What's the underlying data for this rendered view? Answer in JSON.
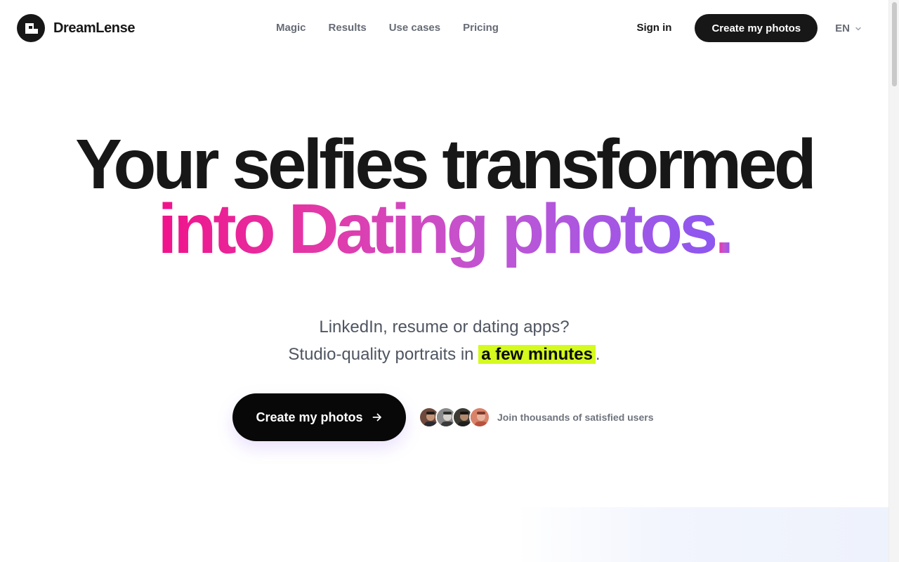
{
  "brand": {
    "name": "DreamLense",
    "logo_icon": "dreamlense-logo-icon"
  },
  "nav": {
    "items": [
      {
        "label": "Magic"
      },
      {
        "label": "Results"
      },
      {
        "label": "Use cases"
      },
      {
        "label": "Pricing"
      }
    ]
  },
  "header": {
    "signin_label": "Sign in",
    "cta_label": "Create my photos",
    "language": "EN",
    "language_icon": "chevron-down-icon"
  },
  "hero": {
    "title_line1": "Your selfies transformed",
    "title_line2_a": "into Dating photos",
    "title_line2_b": ".",
    "subtitle_line1": "LinkedIn, resume or dating apps?",
    "subtitle_line2_before": "Studio-quality portraits in",
    "subtitle_highlight": "a few minutes",
    "subtitle_line2_after": ".",
    "cta_label": "Create my photos",
    "cta_icon": "arrow-right-icon",
    "social_proof": "Join thousands of satisfied users",
    "highlight_color": "#d4fa1e",
    "gradient_colors": [
      "#f0128a",
      "#c056d4",
      "#8d57f0"
    ]
  }
}
